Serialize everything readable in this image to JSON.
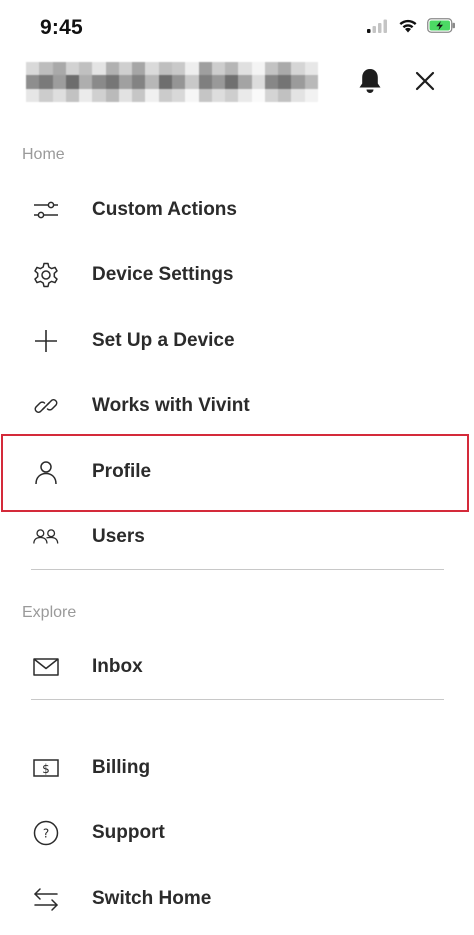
{
  "status_bar": {
    "time": "9:45",
    "signal_icon": "cellular-signal-icon",
    "wifi_icon": "wifi-icon",
    "battery_icon": "battery-charging-icon"
  },
  "header": {
    "account_name": "",
    "bell_icon": "bell-icon",
    "close_icon": "close-icon"
  },
  "sections": {
    "home_label": "Home",
    "explore_label": "Explore"
  },
  "menu": {
    "custom_actions": "Custom Actions",
    "device_settings": "Device Settings",
    "set_up_device": "Set Up a Device",
    "works_with_vivint": "Works with Vivint",
    "profile": "Profile",
    "users": "Users",
    "inbox": "Inbox",
    "billing": "Billing",
    "support": "Support",
    "switch_home": "Switch Home"
  },
  "highlight": {
    "target": "profile",
    "color": "#d42a3a"
  },
  "colors": {
    "label_gray": "#9a9a9a",
    "divider": "#c8c8c8",
    "battery_green": "#4cd964"
  }
}
